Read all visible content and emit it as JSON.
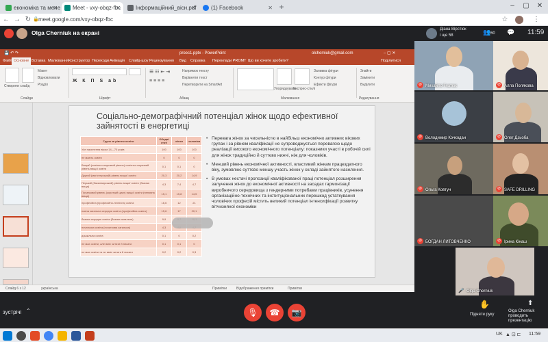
{
  "browser": {
    "tabs": [
      {
        "label": "економіка та менедж…",
        "favicon_color": "#34a853"
      },
      {
        "label": "Meet - vxy-obqz-fbc",
        "favicon_color": "#00897b"
      },
      {
        "label": "Інформаційний_вісн.pdf",
        "favicon_color": "#5f6368"
      },
      {
        "label": "(1) Facebook",
        "favicon_color": "#1877f2"
      }
    ],
    "new_tab": "+",
    "url": "meet.google.com/vxy-obqz-fbc",
    "minimize": "–",
    "maximize": "▢",
    "close": "✕"
  },
  "meet_header": {
    "presenter_label": "Olga Cherniuk на екрані",
    "self_name": "Діана Вірстюк",
    "self_sub": "і ще 58",
    "participants_count": "60",
    "time": "11:59"
  },
  "powerpoint": {
    "window_title": "proec1.pptx - PowerPoint",
    "user": "olchemiuk@gmail.com",
    "tabs": [
      "Файл",
      "Вставка",
      "Малювання",
      "Конструктор",
      "Переходи",
      "Анімація",
      "Слайд-шоу",
      "Рецензування",
      "Вид",
      "Справка",
      "Переклади PROMT",
      "Що ви хочете зробити?",
      "Поділитися"
    ],
    "ribbon": {
      "create_slide": "Створити слайд",
      "layout": "Макет",
      "reset": "Відновлювати",
      "section": "Розділ",
      "slides_group": "Слайди",
      "font_group": "Шрифт",
      "paragraph_group": "Абзац",
      "drawing_group": "Малювання",
      "editing_group": "Редагування",
      "text_direction": "Напрямок тексту",
      "align_text": "Вирівняти текст",
      "convert_smartart": "Перетворити на SmartArt",
      "arrange": "Упорядкувати",
      "quick_styles": "Експрес-стилі",
      "fill": "Заливка фігури",
      "outline": "Контур фігури",
      "effects": "Ефекти фігури",
      "find": "Знайти",
      "replace": "Замінити",
      "select": "Виділити"
    },
    "slide": {
      "title": "Соціально-демографічний потенціал жінок щодо ефективної зайнятості в енергетиці",
      "table_headers": [
        "Група за рівнем освіти",
        "Обидві статі",
        "жінки",
        "чоловіки"
      ],
      "table_rows": [
        [
          "Усе населення віком 14—70 років",
          "100",
          "100",
          "100"
        ],
        [
          "не мають освіти",
          "0",
          "0",
          "0"
        ],
        [
          "Вищий (освітньо-науковий рівень) освітньо-науковий рівень вищої освіти",
          "0,1",
          "0,1",
          "0"
        ],
        [
          "Другий (магістерський) рівень вищої освіти",
          "20,3",
          "20,2",
          "14,9"
        ],
        [
          "Перший (бакалаврський) рівень вищої освіти (базова вища)",
          "4,3",
          "7,4",
          "4,7"
        ],
        [
          "Початковий рівень (короткий цикл) вищої освіти (неповна вища)",
          "15,1",
          "15,8",
          "14,5"
        ],
        [
          "професійна (професійно-технічна) освіта",
          "16,6",
          "12",
          "21"
        ],
        [
          "повна загальна середня освіта (професійна освіта)",
          "15,6",
          "17",
          "20,1"
        ],
        [
          "базова середня освіта (базова загальна)",
          "9,9",
          "9,7",
          "10,1"
        ],
        [
          "початкова освіта (початкова загальна)",
          "4,3",
          "4,6",
          "4,7"
        ],
        [
          "дошкільна освіта",
          "0,1",
          "0",
          "0,2"
        ],
        [
          "не має освіти, але вміє читати й писати",
          "0,1",
          "0,1",
          "0"
        ],
        [
          "не має освіти та не вміє читати й писати",
          "0,2",
          "0,2",
          "0,3"
        ]
      ],
      "bullets": [
        "Перевага жінок за чисельністю в найбільш економічно активних вікових групах і за рівнем кваліфікації не супроводжується перевагою щодо реалізації високого економічного потенціалу: показники участі в робочій силі для жінок традиційно й суттєво нижчі, ніж для чоловіків.",
        "Менший рівень економічної активності, властивий жінкам працездатного віку, зумовлює суттєво меншу участь жінок у складі зайнятого населення.",
        "В умовах нестачі пропозиції кваліфікованої праці потенціал розширення залучення жінок до економічної активності на засадах гармонізації виробничого середовища з гендерними потребами працівників, усунення організаційно-технічних та інституціональних перешкод устаткування чоловічих професій містить великий потенціал інтенсифікації розвитку вітчизняної економіки"
      ]
    },
    "status": {
      "slide_info": "Слайд 6 з 12",
      "lang": "українська",
      "notes": "Примітки",
      "comments": "Відображення примітки",
      "zoom": "Примітки"
    }
  },
  "participants": [
    {
      "name": "Михайло Гнатюк",
      "muted": true
    },
    {
      "name": "Алла Полякова",
      "muted": true
    },
    {
      "name": "Володимир Кочкодан",
      "muted": true
    },
    {
      "name": "Олег Дзьоба",
      "muted": true
    },
    {
      "name": "Ольга Ковтун",
      "muted": true
    },
    {
      "name": "SAFE DRILLING",
      "muted": true
    },
    {
      "name": "БОГДАН ЛИТОВЧЕНКО",
      "muted": true
    },
    {
      "name": "Ірина Кінаш",
      "muted": true
    },
    {
      "name": "Olga Cherniuk",
      "muted": false
    }
  ],
  "bottom": {
    "meeting_label": "зустрічі",
    "raise_hand": "Підняти руку",
    "presenting": "Olga Cherniuk проводить презентацію"
  },
  "taskbar": {
    "lang": "UK",
    "time": "11:59"
  },
  "colors": {
    "ppt_accent": "#b7472a",
    "meet_bg": "#202124",
    "hangup": "#ea4335"
  }
}
